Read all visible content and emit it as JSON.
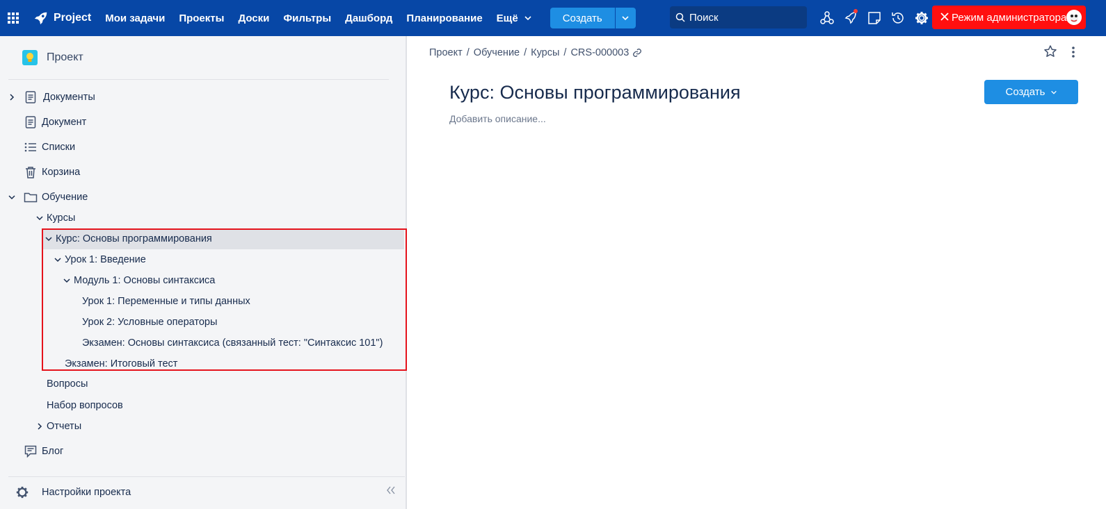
{
  "topbar": {
    "brand": "Project",
    "nav": [
      "Мои задачи",
      "Проекты",
      "Доски",
      "Фильтры",
      "Дашборд",
      "Планирование",
      "Ещё"
    ],
    "create_label": "Создать",
    "search_placeholder": "Поиск",
    "admin_label": "Режим администратора"
  },
  "sidebar": {
    "project_name": "Проект",
    "items": {
      "documents": "Документы",
      "document": "Документ",
      "lists": "Списки",
      "trash": "Корзина",
      "learning": "Обучение",
      "courses": "Курсы",
      "course": "Курс: Основы программирования",
      "lesson1": "Урок 1: Введение",
      "module1": "Модуль 1: Основы синтаксиса",
      "lesson_vars": "Урок 1: Переменные и типы данных",
      "lesson_cond": "Урок 2: Условные операторы",
      "exam_syntax": "Экзамен: Основы синтаксиса (связанный тест: \"Синтаксис 101\")",
      "exam_final": "Экзамен: Итоговый тест",
      "questions": "Вопросы",
      "question_set": "Набор вопросов",
      "reports": "Отчеты",
      "blog": "Блог",
      "settings": "Настройки проекта"
    }
  },
  "main": {
    "breadcrumb": [
      "Проект",
      "Обучение",
      "Курсы",
      "CRS-000003"
    ],
    "title": "Курс: Основы программирования",
    "description_placeholder": "Добавить описание...",
    "create_label": "Создать"
  },
  "colors": {
    "topbar": "#0747A6",
    "accent": "#1E8EE3",
    "admin": "#FF0F0F",
    "highlight_border": "#E5131C"
  }
}
